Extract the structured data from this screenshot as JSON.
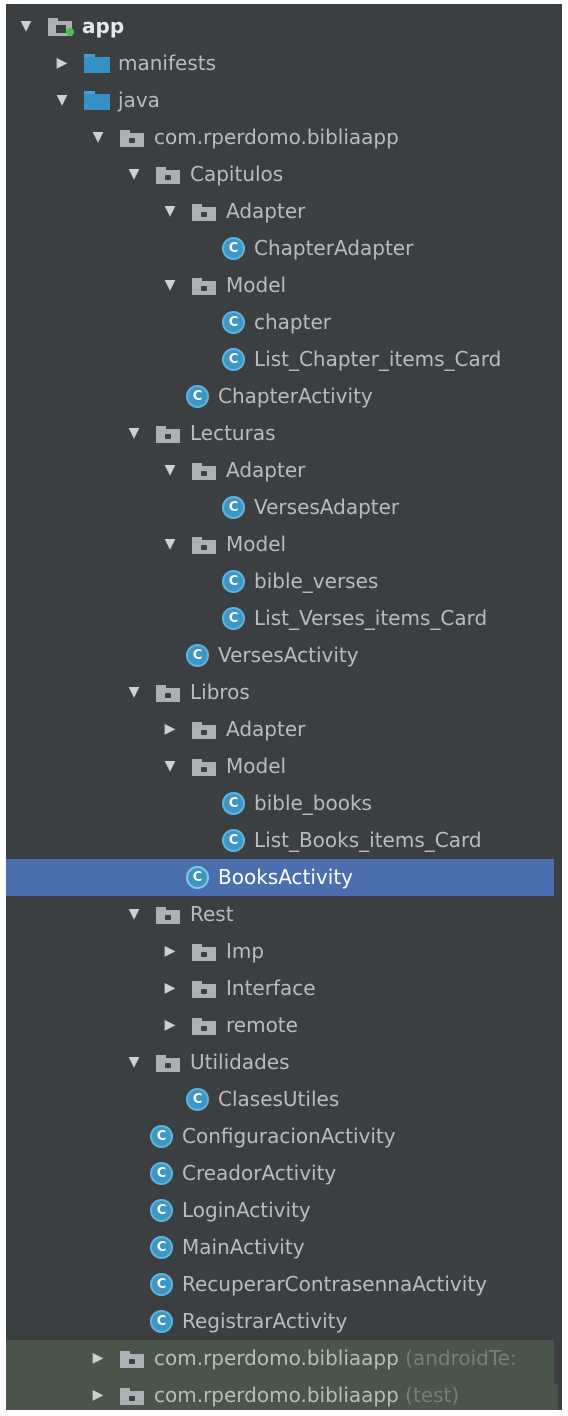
{
  "tree": [
    {
      "label": "app",
      "type": "app",
      "depth": 0,
      "expanded": true,
      "bold": true
    },
    {
      "label": "manifests",
      "type": "folder",
      "depth": 1,
      "expanded": false
    },
    {
      "label": "java",
      "type": "folder",
      "depth": 1,
      "expanded": true
    },
    {
      "label": "com.rperdomo.bibliaapp",
      "type": "package",
      "depth": 2,
      "expanded": true
    },
    {
      "label": "Capitulos",
      "type": "package",
      "depth": 3,
      "expanded": true
    },
    {
      "label": "Adapter",
      "type": "package",
      "depth": 4,
      "expanded": true
    },
    {
      "label": "ChapterAdapter",
      "type": "class",
      "depth": 5
    },
    {
      "label": "Model",
      "type": "package",
      "depth": 4,
      "expanded": true
    },
    {
      "label": "chapter",
      "type": "class",
      "depth": 5
    },
    {
      "label": "List_Chapter_items_Card",
      "type": "class",
      "depth": 5
    },
    {
      "label": "ChapterActivity",
      "type": "class",
      "depth": 4
    },
    {
      "label": "Lecturas",
      "type": "package",
      "depth": 3,
      "expanded": true
    },
    {
      "label": "Adapter",
      "type": "package",
      "depth": 4,
      "expanded": true
    },
    {
      "label": "VersesAdapter",
      "type": "class",
      "depth": 5
    },
    {
      "label": "Model",
      "type": "package",
      "depth": 4,
      "expanded": true
    },
    {
      "label": "bible_verses",
      "type": "class",
      "depth": 5
    },
    {
      "label": "List_Verses_items_Card",
      "type": "class",
      "depth": 5
    },
    {
      "label": "VersesActivity",
      "type": "class",
      "depth": 4
    },
    {
      "label": "Libros",
      "type": "package",
      "depth": 3,
      "expanded": true
    },
    {
      "label": "Adapter",
      "type": "package",
      "depth": 4,
      "expanded": false
    },
    {
      "label": "Model",
      "type": "package",
      "depth": 4,
      "expanded": true
    },
    {
      "label": "bible_books",
      "type": "class",
      "depth": 5
    },
    {
      "label": "List_Books_items_Card",
      "type": "class",
      "depth": 5
    },
    {
      "label": "BooksActivity",
      "type": "class",
      "depth": 4,
      "selected": true
    },
    {
      "label": "Rest",
      "type": "package",
      "depth": 3,
      "expanded": true
    },
    {
      "label": "Imp",
      "type": "package",
      "depth": 4,
      "expanded": false
    },
    {
      "label": "Interface",
      "type": "package",
      "depth": 4,
      "expanded": false
    },
    {
      "label": "remote",
      "type": "package",
      "depth": 4,
      "expanded": false
    },
    {
      "label": "Utilidades",
      "type": "package",
      "depth": 3,
      "expanded": true
    },
    {
      "label": "ClasesUtiles",
      "type": "class",
      "depth": 4
    },
    {
      "label": "ConfiguracionActivity",
      "type": "class",
      "depth": 3
    },
    {
      "label": "CreadorActivity",
      "type": "class",
      "depth": 3
    },
    {
      "label": "LoginActivity",
      "type": "class",
      "depth": 3
    },
    {
      "label": "MainActivity",
      "type": "class",
      "depth": 3
    },
    {
      "label": "RecuperarContrasennaActivity",
      "type": "class",
      "depth": 3
    },
    {
      "label": "RegistrarActivity",
      "type": "class",
      "depth": 3
    },
    {
      "label": "com.rperdomo.bibliaapp",
      "type": "package",
      "depth": 2,
      "expanded": false,
      "suffix": "(androidTe:",
      "test": true
    },
    {
      "label": "com.rperdomo.bibliaapp",
      "type": "package",
      "depth": 2,
      "expanded": false,
      "suffix": "(test)",
      "test": true
    }
  ],
  "icons": {
    "expanded": "▼",
    "collapsed": "▶",
    "class_letter": "C"
  },
  "colors": {
    "background": "#3c3f41",
    "selection": "#4b6eaf",
    "test_background": "#49544a",
    "folder_blue": "#3591c6",
    "package_gray": "#aab0b4",
    "class_blue": "#3e96c4"
  }
}
